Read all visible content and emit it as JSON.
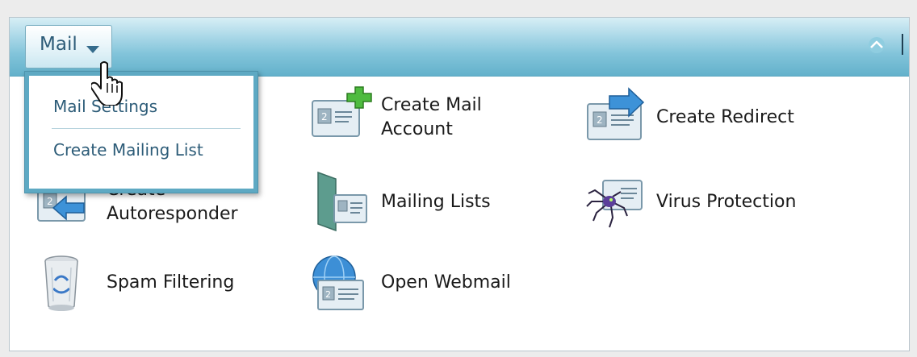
{
  "menu_button": {
    "label": "Mail"
  },
  "dropdown": {
    "items": [
      {
        "label": "Mail Settings"
      },
      {
        "label": "Create Mailing List"
      }
    ]
  },
  "tools": [
    {
      "label_line1": "Create Mail",
      "label_line2": "Account",
      "icon": "mail-card-add-icon"
    },
    {
      "label": "Create Redirect",
      "icon": "mail-redirect-icon"
    },
    {
      "label_line1": "Create",
      "label_line2": "Autoresponder",
      "icon": "autoresponder-icon"
    },
    {
      "label": "Mailing Lists",
      "icon": "mailing-lists-icon"
    },
    {
      "label": "Virus Protection",
      "icon": "virus-protection-icon"
    },
    {
      "label": "Spam Filtering",
      "icon": "recycle-bin-icon"
    },
    {
      "label": "Open Webmail",
      "icon": "webmail-globe-icon"
    }
  ],
  "colors": {
    "header_top": "#d7eef5",
    "header_bottom": "#63b1cb",
    "menu_text": "#2d5c78",
    "label_text": "#1a1a1a"
  }
}
